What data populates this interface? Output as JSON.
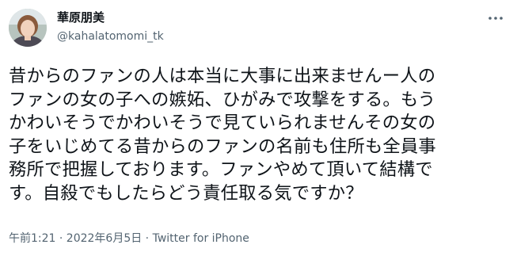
{
  "author": {
    "display_name": "華原朋美",
    "handle": "@kahalatomomi_tk"
  },
  "more_icon": "more-horizontal-icon",
  "tweet": {
    "lines": [
      "昔からのファンの人は本当に大事に出来ませんー人の",
      "ファンの女の子への嫉妬、ひがみで攻撃をする。もう",
      "かわいそうでかわいそうで見ていられませんその女の",
      "子をいじめてる昔からのファンの名前も住所も全員事",
      "務所で把握しております。ファンやめて頂いて結構で",
      "す。自殺でもしたらどう責任取る気ですか？"
    ]
  },
  "meta": {
    "timestamp": "午前1:21 · 2022年6月5日",
    "separator": " · ",
    "source": "Twitter for iPhone"
  },
  "colors": {
    "text_primary": "#0f1419",
    "text_secondary": "#536471"
  }
}
